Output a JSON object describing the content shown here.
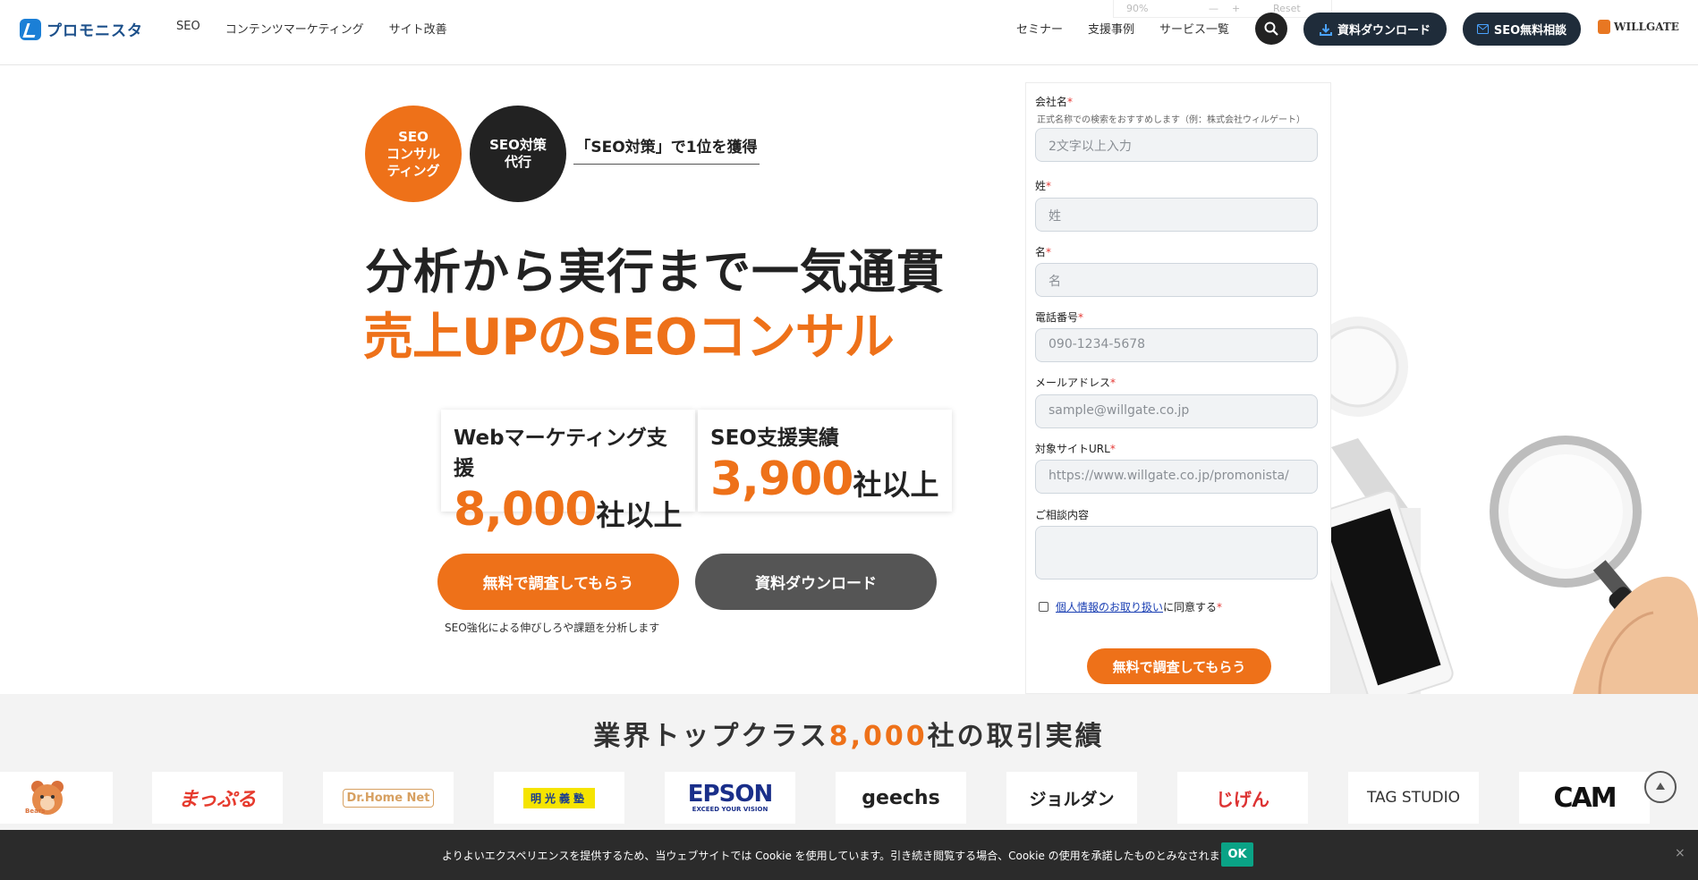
{
  "header": {
    "logo_text": "プロモニスタ",
    "nav_left": [
      "SEO",
      "コンテンツマーケティング",
      "サイト改善"
    ],
    "nav_right": [
      "セミナー",
      "支援事例",
      "サービス一覧"
    ],
    "zoom": {
      "level": "90%",
      "minus": "—",
      "plus": "+",
      "reset": "Reset"
    },
    "download_btn": "資料ダウンロード",
    "seo_btn": "SEO無料相談",
    "company": "WILLGATE"
  },
  "hero": {
    "badge1": "SEO\nコンサル\nティング",
    "badge2": "SEO対策\n代行",
    "tag": "「SEO対策」で1位を獲得",
    "headline1": "分析から実行まで一気通貫",
    "headline2": "売上UPのSEOコンサル",
    "stats": [
      {
        "title": "Webマーケティング支援",
        "number": "8,000",
        "unit": "社以上"
      },
      {
        "title": "SEO支援実績",
        "number": "3,900",
        "unit": "社以上"
      }
    ],
    "cta_primary": "無料で調査してもらう",
    "cta_secondary": "資料ダウンロード",
    "cta_note": "SEO強化による伸びしろや課題を分析します"
  },
  "form": {
    "company_label": "会社名",
    "company_help": "正式名称での検索をおすすめします（例：株式会社ウィルゲート）",
    "company_placeholder": "2文字以上入力",
    "last_label": "姓",
    "last_placeholder": "姓",
    "first_label": "名",
    "first_placeholder": "名",
    "phone_label": "電話番号",
    "phone_placeholder": "090-1234-5678",
    "email_label": "メールアドレス",
    "email_placeholder": "sample@willgate.co.jp",
    "url_label": "対象サイトURL",
    "url_placeholder": "https://www.willgate.co.jp/promonista/",
    "message_label": "ご相談内容",
    "required_mark": "*",
    "privacy_link": "個人情報のお取り扱い",
    "privacy_suffix": "に同意する",
    "submit": "無料で調査してもらう"
  },
  "clients": {
    "title_pre": "業界トップクラス",
    "title_num": "8,000",
    "title_post": "社の取引実績",
    "logos": [
      "Bears",
      "まっぷる",
      "Dr.Home Net",
      "明光義塾",
      "EPSON",
      "geechs",
      "ジョルダン",
      "じげん",
      "TAG STUDIO",
      "CAM"
    ],
    "epson_sub": "EXCEED YOUR VISION"
  },
  "cookie": {
    "text": "よりよいエクスペリエンスを提供するため、当ウェブサイトでは Cookie を使用しています。引き続き閲覧する場合、Cookie の使用を承諾したものとみなされます。",
    "ok": "OK",
    "close": "×"
  },
  "colors": {
    "accent": "#ee7119",
    "dark": "#1f2c3a",
    "cookie_ok": "#0aa386"
  },
  "icons": {
    "search": "search-icon",
    "download": "download-icon",
    "mail": "mail-icon",
    "to_top": "arrow-up-icon",
    "close": "close-icon"
  }
}
